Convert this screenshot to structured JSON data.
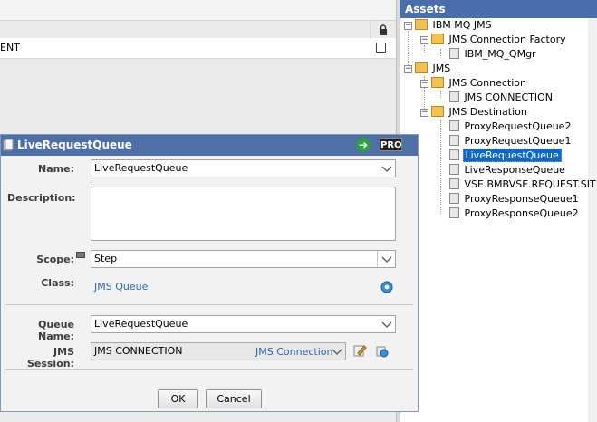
{
  "left_panel": {
    "row_text": "ENT"
  },
  "assets": {
    "title": "Assets",
    "tree": [
      {
        "label": "IBM MQ JMS"
      },
      {
        "label": "JMS Connection Factory"
      },
      {
        "label": "IBM_MQ_QMgr"
      },
      {
        "label": "JMS"
      },
      {
        "label": "JMS Connection"
      },
      {
        "label": "JMS CONNECTION"
      },
      {
        "label": "JMS Destination"
      },
      {
        "label": "ProxyRequestQueue2"
      },
      {
        "label": "ProxyRequestQueue1"
      },
      {
        "label": "LiveRequestQueue",
        "selected": true
      },
      {
        "label": "LiveResponseQueue"
      },
      {
        "label": "VSE.BMBVSE.REQUEST.SIT"
      },
      {
        "label": "ProxyResponseQueue1"
      },
      {
        "label": "ProxyResponseQueue2"
      }
    ]
  },
  "dialog": {
    "title": "LiveRequestQueue",
    "pro_badge": "PRO",
    "labels": {
      "name": "Name:",
      "description": "Description:",
      "scope": "Scope:",
      "class": "Class:",
      "queue_name": "Queue Name:",
      "jms_session": "JMS Session:"
    },
    "name_value": "LiveRequestQueue",
    "description_value": "",
    "scope_value": "Step",
    "class_value": "JMS Queue",
    "queue_name_value": "LiveRequestQueue",
    "jms_session_value": "JMS CONNECTION",
    "jms_session_type": "JMS Connection",
    "ok_label": "OK",
    "cancel_label": "Cancel"
  },
  "colors": {
    "title_bar": "#4f70a6",
    "selection": "#0a68d0",
    "link": "#2f65a8"
  }
}
